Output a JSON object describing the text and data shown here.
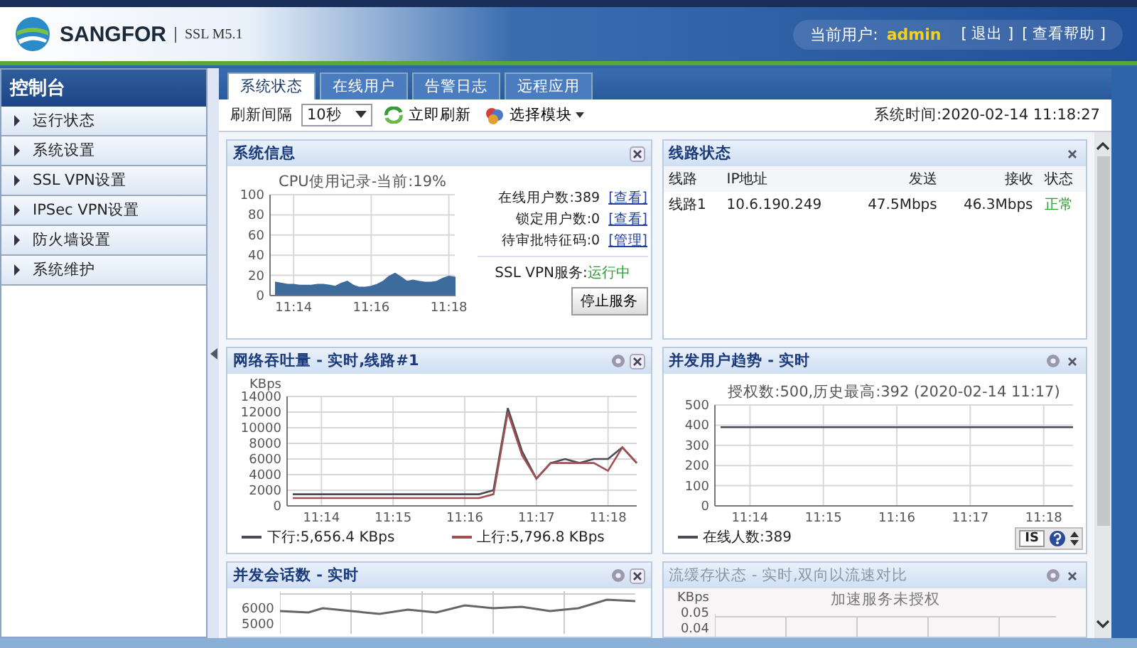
{
  "header": {
    "brand": "SANGFOR",
    "product": "SSL M5.1",
    "user_label": "当前用户:",
    "user_name": "admin",
    "links": [
      "[ 退出 ]",
      "[ 查看帮助 ]"
    ]
  },
  "sidebar": {
    "title": "控制台",
    "items": [
      {
        "label": "运行状态",
        "selected": false
      },
      {
        "label": "系统设置",
        "selected": false
      },
      {
        "label": "SSL VPN设置",
        "selected": false
      },
      {
        "label": "IPSec VPN设置",
        "selected": false
      },
      {
        "label": "防火墙设置",
        "selected": false
      },
      {
        "label": "系统维护",
        "selected": false
      }
    ]
  },
  "tabs": [
    {
      "label": "系统状态",
      "selected": true
    },
    {
      "label": "在线用户",
      "selected": false
    },
    {
      "label": "告警日志",
      "selected": false
    },
    {
      "label": "远程应用",
      "selected": false
    }
  ],
  "toolbar": {
    "interval_label": "刷新间隔",
    "interval_value": "10秒",
    "refresh": "立即刷新",
    "modules": "选择模块",
    "system_time": "系统时间:2020-02-14 11:18:27"
  },
  "system_info": {
    "title": "系统信息",
    "chart_data": {
      "type": "area",
      "title": "CPU使用记录-当前:19%",
      "categories": [
        null,
        null,
        null,
        "11:14",
        null,
        null,
        null,
        null,
        null,
        null,
        null,
        null,
        null,
        null,
        null,
        null,
        "11:16",
        null,
        null,
        null,
        null,
        null,
        null,
        null,
        null,
        null,
        null,
        null,
        null,
        "11:18",
        null
      ],
      "series": [
        {
          "color": "#3d6b9c",
          "values": [
            13,
            12,
            11,
            11,
            10,
            10,
            10,
            11,
            11,
            10,
            9,
            12,
            14,
            10,
            8,
            8,
            9,
            11,
            14,
            19,
            22,
            18,
            14,
            15,
            14,
            13,
            13,
            14,
            17,
            19,
            18
          ]
        }
      ],
      "ylim": [
        0,
        100
      ],
      "yticks": [
        0,
        20,
        40,
        60,
        80,
        100
      ],
      "grid": true
    },
    "stats": [
      {
        "label": "在线用户数:389",
        "link": "[查看]"
      },
      {
        "label": "锁定用户数:0",
        "link": "[查看]"
      },
      {
        "label": "待审批特征码:0",
        "link": "[管理]"
      }
    ],
    "service_label": "SSL VPN服务:",
    "service_state": "运行中",
    "stop_button": "停止服务"
  },
  "line_status": {
    "title": "线路状态",
    "columns": [
      "线路",
      "IP地址",
      "发送",
      "接收",
      "状态"
    ],
    "rows": [
      [
        "线路1",
        "10.6.190.249",
        "47.5Mbps",
        "46.3Mbps",
        "正常"
      ]
    ]
  },
  "throughput": {
    "title": "网络吞吐量 - 实时,线路#1",
    "chart_data": {
      "type": "line",
      "ylabel": "KBps",
      "categories": [
        null,
        null,
        "11:14",
        null,
        null,
        null,
        null,
        "11:15",
        null,
        null,
        null,
        null,
        "11:16",
        null,
        null,
        null,
        null,
        "11:17",
        null,
        null,
        null,
        null,
        "11:18",
        null,
        null
      ],
      "series": [
        {
          "name": "下行:5,656.4 KBps",
          "color": "#4a4a58",
          "values": [
            1500,
            1500,
            1500,
            1500,
            1500,
            1500,
            1500,
            1500,
            1500,
            1500,
            1500,
            1500,
            1500,
            1500,
            2000,
            12500,
            7000,
            3500,
            5500,
            6000,
            5500,
            6000,
            6000,
            7500,
            5500
          ]
        },
        {
          "name": "上行:5,796.8 KBps",
          "color": "#a05050",
          "values": [
            1000,
            1000,
            1000,
            1000,
            1000,
            1000,
            1000,
            1000,
            1000,
            1000,
            1000,
            1000,
            1000,
            1000,
            1500,
            12000,
            6500,
            3500,
            5500,
            5500,
            5500,
            5500,
            4500,
            7500,
            5500
          ]
        }
      ],
      "ylim": [
        0,
        14000
      ],
      "yticks": [
        0,
        2000,
        4000,
        6000,
        8000,
        10000,
        12000,
        14000
      ],
      "grid": true
    }
  },
  "users_trend": {
    "title": "并发用户趋势 - 实时",
    "chart_data": {
      "type": "line",
      "title": "授权数:500,历史最高:392 (2020-02-14 11:17)",
      "categories": [
        null,
        null,
        "11:14",
        null,
        null,
        null,
        null,
        "11:15",
        null,
        null,
        null,
        null,
        "11:16",
        null,
        null,
        null,
        null,
        "11:17",
        null,
        null,
        null,
        null,
        "11:18",
        null,
        null
      ],
      "series": [
        {
          "name": "在线人数:389",
          "color": "#4a4a58",
          "values": [
            390,
            390,
            390,
            390,
            390,
            390,
            390,
            390,
            390,
            390,
            390,
            390,
            390,
            390,
            390,
            390,
            390,
            390,
            390,
            390,
            390,
            390,
            390,
            390,
            390
          ]
        }
      ],
      "ylim": [
        0,
        500
      ],
      "yticks": [
        0,
        100,
        200,
        300,
        400,
        500
      ],
      "grid": true
    },
    "corner_badge": "IS"
  },
  "sessions": {
    "title": "并发会话数 - 实时",
    "axis_labels": [
      "6000",
      "5000"
    ]
  },
  "cache": {
    "title": "流缓存状态 - 实时,双向以流速对比",
    "unit": "KBps",
    "notice": "加速服务未授权",
    "axis_labels": [
      "0.05",
      "0.04"
    ]
  }
}
